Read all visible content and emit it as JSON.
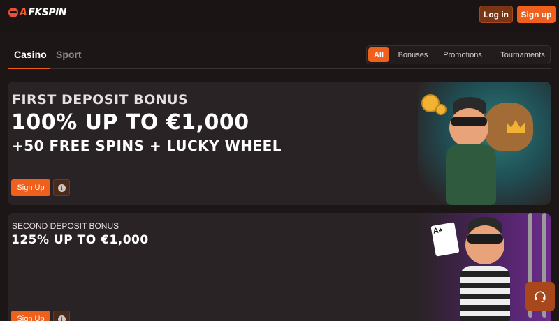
{
  "header": {
    "logo_prefix": "A",
    "logo_rest": "FKSPIN",
    "login_label": "Log in",
    "signup_label": "Sign up"
  },
  "tabs": [
    {
      "label": "Casino",
      "active": true
    },
    {
      "label": "Sport",
      "active": false
    }
  ],
  "filters": [
    {
      "label": "All",
      "active": true
    },
    {
      "label": "Bonuses",
      "active": false
    },
    {
      "label": "Promotions",
      "active": false
    },
    {
      "label": "Tournaments",
      "active": false
    }
  ],
  "promos": [
    {
      "eyebrow": "FIRST DEPOSIT BONUS",
      "title": "100% UP TO €1,000",
      "subtitle": "+50 FREE SPINS + LUCKY WHEEL",
      "cta_label": "Sign Up",
      "info_icon": "info-icon"
    },
    {
      "eyebrow": "SECOND DEPOSIT BONUS",
      "title": "125% UP TO €1,000",
      "cta_label": "Sign Up",
      "info_icon": "info-icon",
      "card_text": "A♠"
    }
  ],
  "support": {
    "icon": "headset-icon"
  },
  "colors": {
    "accent": "#f0601d",
    "background": "#1c1617",
    "card": "#2a2325"
  }
}
